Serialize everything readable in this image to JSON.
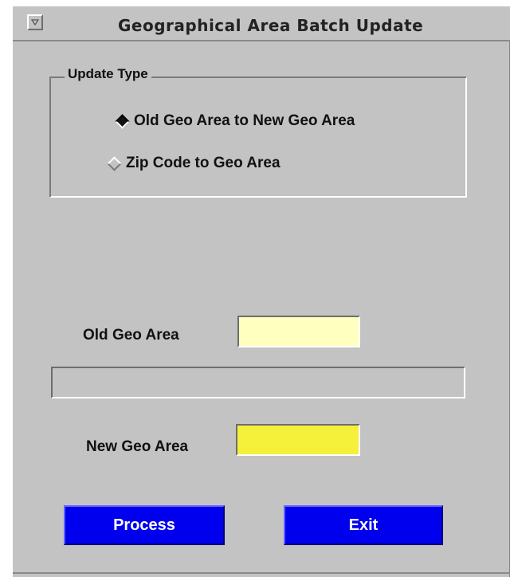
{
  "window": {
    "title": "Geographical Area Batch Update"
  },
  "update_type": {
    "legend": "Update Type",
    "options": [
      {
        "label": "Old Geo Area to New Geo Area",
        "selected": true
      },
      {
        "label": "Zip Code to Geo Area",
        "selected": false
      }
    ]
  },
  "old_geo_area": {
    "label": "Old Geo Area",
    "value": "",
    "color": "#ffffc0"
  },
  "status": {
    "text": ""
  },
  "new_geo_area": {
    "label": "New Geo Area",
    "value": "",
    "color": "#f5f03a"
  },
  "buttons": {
    "process": "Process",
    "exit": "Exit",
    "color": "#0000ee"
  },
  "icons": {
    "window_menu": "chevron-down-icon"
  }
}
